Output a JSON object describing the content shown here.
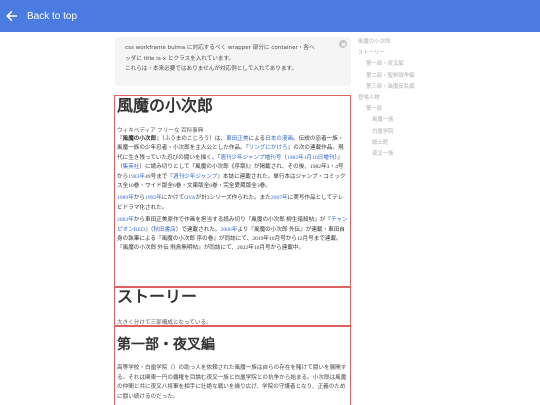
{
  "topbar": {
    "back_label": "Back to top"
  },
  "notice": {
    "line1": "css workframe bulma に対応するべく wrapper 部分に container・各ヘ",
    "line2": "ッダに title is-x とクラスを入れています。",
    "line3": "これらは・本来必要ではありませんが対応例として入れてあります。"
  },
  "toc": [
    {
      "label": "風魔の小次郎",
      "level": 1
    },
    {
      "label": "ストーリー",
      "level": 1
    },
    {
      "label": "第一部・夜叉編",
      "level": 2
    },
    {
      "label": "第二部・聖剣戦争編",
      "level": 2
    },
    {
      "label": "第三部・風魔反乱編",
      "level": 2
    },
    {
      "label": "登場人物",
      "level": 1
    },
    {
      "label": "第一部",
      "level": 2
    },
    {
      "label": "風魔一族",
      "level": 3
    },
    {
      "label": "白凰学院",
      "level": 3
    },
    {
      "label": "誠士館",
      "level": 3
    },
    {
      "label": "夜叉一族",
      "level": 3
    }
  ],
  "main": {
    "title": "風魔の小次郎",
    "subtitle": "ウィキペディア フリーな 百科事典",
    "p1": [
      {
        "t": "『"
      },
      {
        "t": "風魔の小次郎",
        "b": true
      },
      {
        "t": "』（ふうまのこじろう）は、"
      },
      {
        "t": "車田正美",
        "link": true
      },
      {
        "t": "による"
      },
      {
        "t": "日本の漫画",
        "link": true
      },
      {
        "t": "。伝説の忍者一族・風魔一族の少年忍者・小次郎を主人公とした作品。"
      },
      {
        "t": "『"
      },
      {
        "t": "リングにかけろ",
        "link": true
      },
      {
        "t": "』の次の連載作品。現代に生き残っていた忍びの闘いを描く。『"
      },
      {
        "t": "週刊少年ジャンプ増刊号",
        "link": true
      },
      {
        "t": "（"
      },
      {
        "t": "1982年1月10日増刊",
        "link": true
      },
      {
        "t": "）』（"
      },
      {
        "t": "集英社",
        "link": true
      },
      {
        "t": "）に読み切りとして『風魔の小次郎《序章》』が掲載され、その後、1982年3・4号から"
      },
      {
        "t": "1983年",
        "link": true
      },
      {
        "t": "49号まで『"
      },
      {
        "t": "週刊少年ジャンプ",
        "link": true
      },
      {
        "t": "』本誌に連載された。単行本はジャンプ・コミックス全10巻・ワイド版全6巻・文庫版全6巻・完全愛蔵版全3巻。"
      }
    ],
    "p2": [
      {
        "t": "1989年",
        "link": true
      },
      {
        "t": "から"
      },
      {
        "t": "1992年",
        "link": true
      },
      {
        "t": "にかけて"
      },
      {
        "t": "OVA",
        "link": true
      },
      {
        "t": "が計3シリーズ作られた。また"
      },
      {
        "t": "2007年",
        "link": true
      },
      {
        "t": "に実写作品としてテレビドラマ化された。"
      }
    ],
    "p3": [
      {
        "t": "2003年",
        "link": true
      },
      {
        "t": "から車田正美原作で作画を担当する読み切り『風魔の小次郎 柳生暗殺帖』が『"
      },
      {
        "t": "チャンピオンRED",
        "link": true
      },
      {
        "t": "』（"
      },
      {
        "t": "秋田書店",
        "link": true
      },
      {
        "t": "）で連載された。"
      },
      {
        "t": "2006年",
        "link": true
      },
      {
        "t": "より『風魔の小次郎 外伝』が連載・車田自身の執筆による『風魔の小次郎 序の巻』が同誌にて、2019年10月号から12月号まで連載。『風魔の小次郎 外伝 飛鳥無明帖』が同誌にて、2022年10月号から連載中。"
      }
    ],
    "story_title": "ストーリー",
    "story_sub": "大きく分けて三部構成となっている。",
    "part1_title": "第一部・夜叉編",
    "part1_body": "高等学校・白凰学院（）の助っ人を依頼された風魔一族は自らの存在を賭けて闘いを展開する。それは関東一円の覇権を目論む夜叉一族と白凰学院との抗争から始まる。小次郎は風魔の仲間と共に夜叉八将軍を相手に壮絶な戦いを繰り広げ、学院の守護者となり、正義のために闘い続けるのだった。"
  }
}
